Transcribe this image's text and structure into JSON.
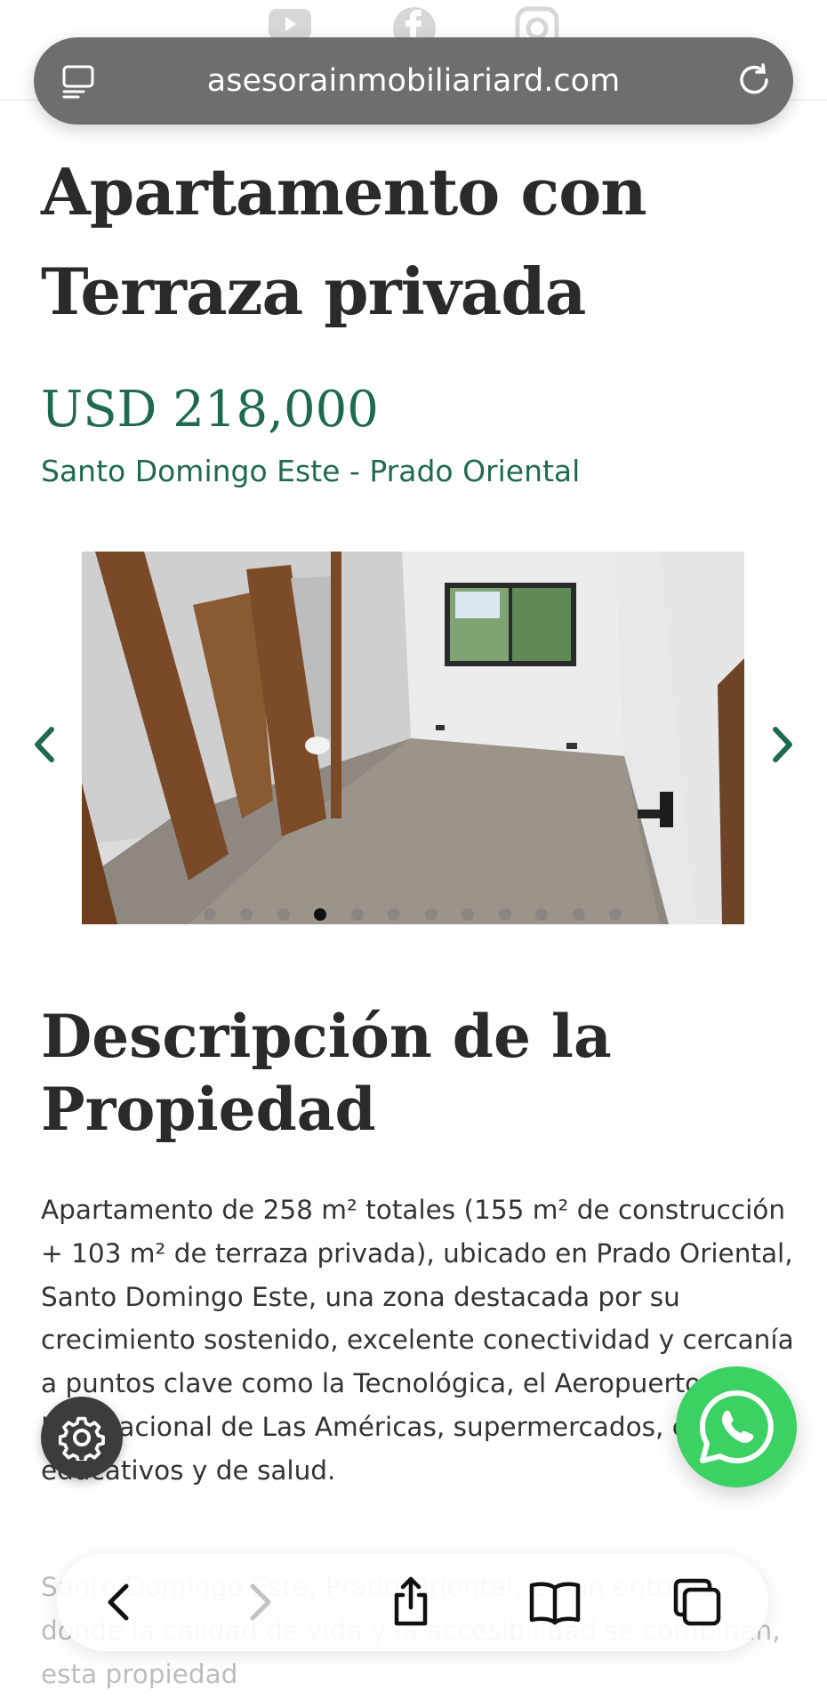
{
  "browser": {
    "url": "asesorainmobiliariard.com",
    "toolbar": [
      "back",
      "forward",
      "share",
      "bookmarks",
      "tabs"
    ]
  },
  "social": [
    "youtube-icon",
    "facebook-icon",
    "instagram-icon"
  ],
  "property": {
    "title": "Apartamento con Terraza privada",
    "price": "USD 218,000",
    "location": "Santo Domingo Este - Prado Oriental"
  },
  "gallery": {
    "dot_count": 12,
    "active_index": 3
  },
  "description": {
    "heading": "Descripción de la Propiedad",
    "paragraph": "Apartamento de 258 m² totales (155 m² de construcción + 103 m² de terraza privada), ubicado en Prado Oriental, Santo Domingo Este, una zona destacada por su crecimiento sostenido, excelente conectividad y cercanía a puntos clave como la Tecnológica, el Aeropuerto Internacional de Las Américas, supermercados, centros educativos y de salud.",
    "paragraph2_partial": "Santo Domingo Este, Prado Oriental, en un entorno donde la calidad de vida y la accesibilidad se combinan, esta propiedad"
  },
  "colors": {
    "accent_green": "#1f6a4f",
    "whatsapp_green": "#3cd163",
    "urlbar_gray": "#6e6e6e"
  }
}
